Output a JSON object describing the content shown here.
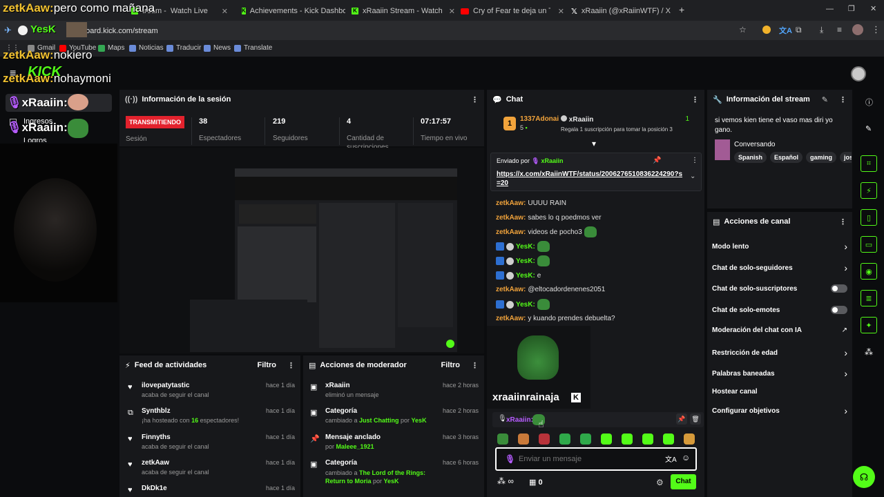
{
  "browser": {
    "tabs": [
      {
        "label": "Watch Live",
        "prefix": "tream -"
      },
      {
        "label": "Achievements - Kick Dashboard"
      },
      {
        "label": "xRaaiin Stream - Watch Live on"
      },
      {
        "label": "Cry of Fear te deja un TRAUMA"
      },
      {
        "label": "xRaaiin (@xRaiinWTF) / X"
      }
    ],
    "url": "board.kick.com/stream",
    "bookmarks": [
      "Gmail",
      "YouTube",
      "Maps",
      "Noticias",
      "Traducir",
      "News",
      "Translate"
    ]
  },
  "overlay": {
    "lines": [
      {
        "user": "zetkAaw:",
        "text": "pero como mañana"
      },
      {
        "user": "zetkAaw:",
        "text": "nokiero"
      },
      {
        "user": "zetkAaw:",
        "text": "nohaymoni"
      }
    ],
    "rain_label": "xRaaiin:",
    "sidebar_label": "Ingresos",
    "sidebar_label2": "Logros"
  },
  "session": {
    "title": "Información de la sesión",
    "live_badge": "TRANSMITIENDO",
    "sesion_label": "Sesión",
    "stats": [
      {
        "value": "38",
        "label": "Espectadores"
      },
      {
        "value": "219",
        "label": "Seguidores"
      },
      {
        "value": "4",
        "label": "Cantidad de suscripciones"
      },
      {
        "value": "07:17:57",
        "label": "Tiempo en vivo"
      }
    ]
  },
  "chat": {
    "title": "Chat",
    "leader": {
      "rank": "1",
      "user": "1337Adonai",
      "count": "5",
      "target": "xRaaiin",
      "target_count": "1",
      "promo": "Regala 1 suscripción para tomar la posición 3"
    },
    "pinned": {
      "by_label": "Enviado por",
      "by_user": "xRaaiin",
      "link": "https://x.com/xRaiinWTF/status/2006276510836224290?s=20"
    },
    "messages": [
      {
        "user": "zetkAaw:",
        "text": "UUUU RAIN"
      },
      {
        "user": "zetkAaw:",
        "text": "sabes lo q poedmos ver"
      },
      {
        "user": "zetkAaw:",
        "text": "videos de pocho3"
      },
      {
        "user": "YesK:",
        "text": ""
      },
      {
        "user": "YesK:",
        "text": ""
      },
      {
        "user": "YesK:",
        "text": "e"
      },
      {
        "user": "zetkAaw:",
        "text": "@eltocadordenenes2051"
      },
      {
        "user": "YesK:",
        "text": ""
      },
      {
        "user": "zetkAaw:",
        "text": "y kuando prendes debuelta?"
      }
    ],
    "popup_name": "xraaiinrainaja",
    "last_msg_user": "xRaaiin:",
    "input_placeholder": "Enviar un mensaje",
    "points": "0",
    "send_label": "Chat"
  },
  "stream_info": {
    "title": "Información del stream",
    "description": "si vemos kien tiene el vaso mas diri yo gano.",
    "category": "Conversando",
    "tags": [
      "Spanish",
      "Español",
      "gaming",
      "jose"
    ]
  },
  "channel_actions": {
    "title": "Acciones de canal",
    "items": [
      {
        "label": "Modo lento",
        "kind": "chevron"
      },
      {
        "label": "Chat de solo-seguidores",
        "kind": "chevron"
      },
      {
        "label": "Chat de solo-suscriptores",
        "kind": "toggle"
      },
      {
        "label": "Chat de solo-emotes",
        "kind": "toggle"
      },
      {
        "label": "Moderación del chat con IA",
        "kind": "external"
      },
      {
        "label": "Restricción de edad",
        "kind": "chevron"
      },
      {
        "label": "Palabras baneadas",
        "kind": "chevron"
      },
      {
        "label": "Hostear canal",
        "kind": "none"
      },
      {
        "label": "Configurar objetivos",
        "kind": "chevron"
      }
    ]
  },
  "activity": {
    "title": "Feed de actividades",
    "filter": "Filtro",
    "rows": [
      {
        "user": "ilovepatytastic",
        "text": "acaba de seguir el canal",
        "time": "hace 1 día"
      },
      {
        "user": "Synthblz",
        "text_pre": "¡ha hosteado con ",
        "count": "16",
        "text_post": " espectadores!",
        "time": "hace 1 día"
      },
      {
        "user": "Finnyths",
        "text": "acaba de seguir el canal",
        "time": "hace 1 día"
      },
      {
        "user": "zetkAaw",
        "text": "acaba de seguir el canal",
        "time": "hace 1 día"
      },
      {
        "user": "DkDk1e",
        "time": "hace 1 día"
      }
    ]
  },
  "modactions": {
    "title": "Acciones de moderador",
    "filter": "Filtro",
    "rows": [
      {
        "title": "xRaaiin",
        "text": "eliminó un mensaje",
        "time": "hace 2 horas"
      },
      {
        "title": "Categoría",
        "pre": "cambiado a ",
        "hl": "Just Chatting",
        "mid": " por ",
        "by": "YesK",
        "time": "hace 2 horas"
      },
      {
        "title": "Mensaje anclado",
        "pre": "por ",
        "hl": "Maleee_1921",
        "time": "hace 3 horas"
      },
      {
        "title": "Categoría",
        "pre": "cambiado a ",
        "hl": "The Lord of the Rings: Return to Moria",
        "mid": " por ",
        "by": "YesK",
        "time": "hace 6 horas"
      }
    ]
  }
}
